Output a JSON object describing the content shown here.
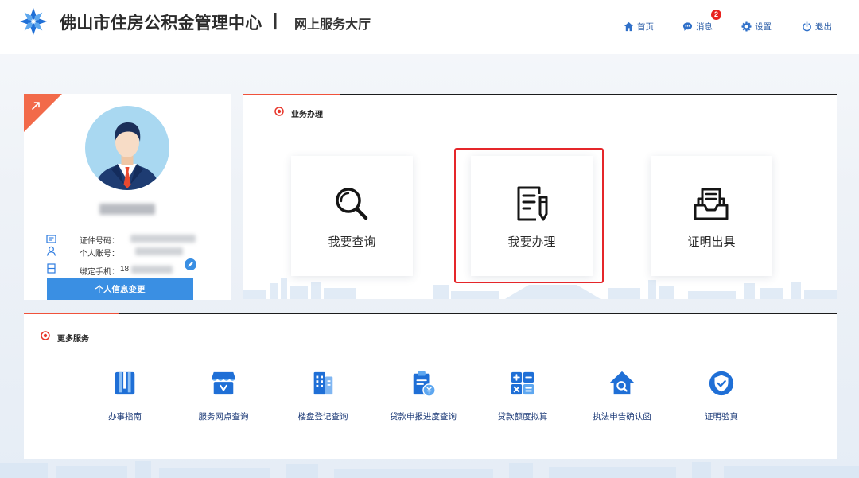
{
  "header": {
    "logo_icon": "snowflake-logo-icon",
    "title": "佛山市住房公积金管理中心",
    "separator": "|",
    "subtitle": "网上服务大厅",
    "nav": [
      {
        "label": "首页",
        "icon": "home-icon"
      },
      {
        "label": "消息",
        "icon": "message-icon",
        "badge": "2"
      },
      {
        "label": "设置",
        "icon": "gear-icon"
      },
      {
        "label": "退出",
        "icon": "power-icon"
      }
    ]
  },
  "profile": {
    "corner_icon": "arrow-up-right-icon",
    "avatar_icon": "businessman-avatar",
    "fields": [
      {
        "label": "证件号码：",
        "icon": "id-card-icon"
      },
      {
        "label": "个人账号：",
        "icon": "person-icon"
      },
      {
        "label": "绑定手机：",
        "icon": "phone-card-icon",
        "value_visible": "18"
      }
    ],
    "edit_icon": "edit-icon",
    "button_label": "个人信息变更"
  },
  "business": {
    "title": "业务办理",
    "cards": [
      {
        "label": "我要查询",
        "icon": "magnifier-icon"
      },
      {
        "label": "我要办理",
        "icon": "document-pen-icon",
        "highlighted": true
      },
      {
        "label": "证明出具",
        "icon": "certificate-tray-icon"
      }
    ]
  },
  "more_services": {
    "title": "更多服务",
    "items": [
      {
        "label": "办事指南",
        "icon": "guide-book-icon"
      },
      {
        "label": "服务网点查询",
        "icon": "service-outlet-icon"
      },
      {
        "label": "楼盘登记查询",
        "icon": "building-icon"
      },
      {
        "label": "贷款申报进度查询",
        "icon": "loan-progress-icon"
      },
      {
        "label": "贷款额度拟算",
        "icon": "calculator-icon"
      },
      {
        "label": "执法申告确认函",
        "icon": "house-search-icon"
      },
      {
        "label": "证明验真",
        "icon": "shield-check-icon"
      }
    ]
  },
  "colors": {
    "brand_blue": "#1f6fd6",
    "nav_blue": "#2d5fa8",
    "accent_red": "#f0523b",
    "highlight_red": "#e5262a",
    "button_blue": "#3a8fe3",
    "badge_red": "#e8231f"
  }
}
